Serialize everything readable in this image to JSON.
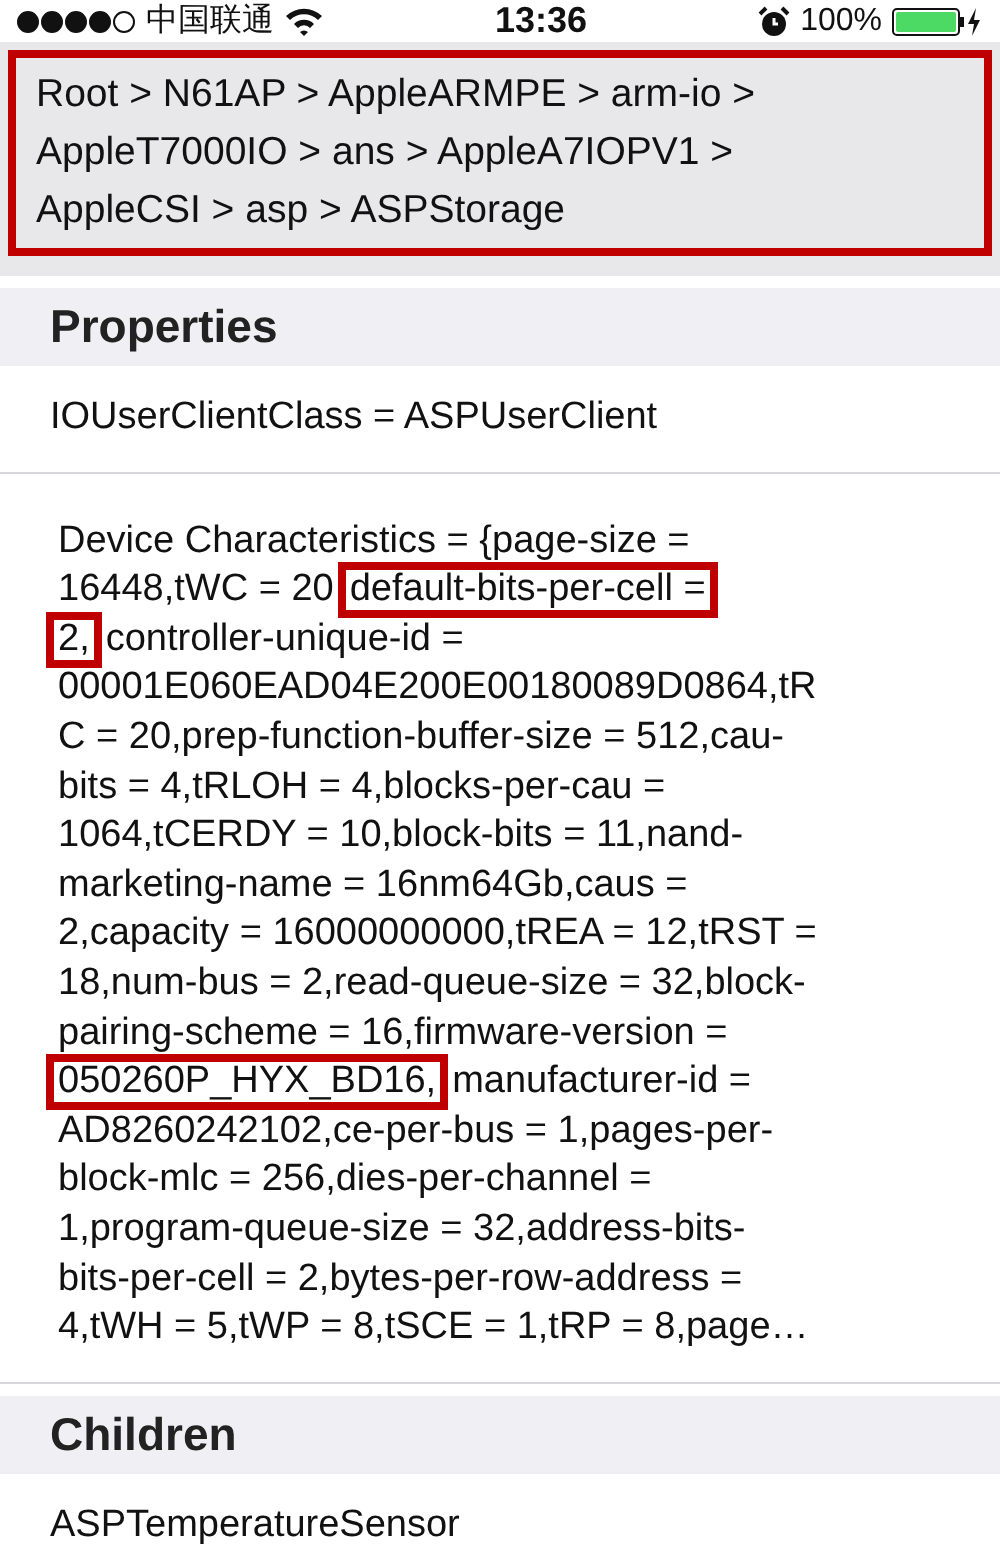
{
  "status_bar": {
    "carrier": "中国联通",
    "time": "13:36",
    "battery": "100%"
  },
  "breadcrumb": {
    "text": "Root > N61AP > AppleARMPE > arm-io > AppleT7000IO > ans > AppleA7IOPV1 > AppleCSI > asp > ASPStorage",
    "marked": true
  },
  "sections": [
    {
      "title": "Properties",
      "rows": [
        {
          "kind": "simple",
          "text": "IOUserClientClass = ASPUserClient"
        },
        {
          "kind": "long",
          "lines": [
            [
              {
                "text": "Device Characteristics = {page-size =",
                "marked": false
              }
            ],
            [
              {
                "text": "16448,tWC = 20 ",
                "marked": false
              },
              {
                "text": "default-bits-per-cell =",
                "marked": true
              }
            ],
            [
              {
                "text": "2,",
                "marked": true
              },
              {
                "text": "controller-unique-id =",
                "marked": false
              }
            ],
            [
              {
                "text": "00001E060EAD04E200E00180089D0864,tR",
                "marked": false
              }
            ],
            [
              {
                "text": "C = 20,prep-function-buffer-size = 512,cau-",
                "marked": false
              }
            ],
            [
              {
                "text": "bits = 4,tRLOH = 4,blocks-per-cau =",
                "marked": false
              }
            ],
            [
              {
                "text": "1064,tCERDY = 10,block-bits = 11,nand-",
                "marked": false
              }
            ],
            [
              {
                "text": "marketing-name = 16nm64Gb,caus =",
                "marked": false
              }
            ],
            [
              {
                "text": "2,capacity = 16000000000,tREA = 12,tRST =",
                "marked": false
              }
            ],
            [
              {
                "text": "18,num-bus = 2,read-queue-size = 32,block-",
                "marked": false
              }
            ],
            [
              {
                "text": "pairing-scheme = 16,firmware-version =",
                "marked": false
              }
            ],
            [
              {
                "text": "050260P_HYX_BD16,",
                "marked": true
              },
              {
                "text": "manufacturer-id =",
                "marked": false
              }
            ],
            [
              {
                "text": "AD8260242102,ce-per-bus = 1,pages-per-",
                "marked": false
              }
            ],
            [
              {
                "text": "block-mlc = 256,dies-per-channel =",
                "marked": false
              }
            ],
            [
              {
                "text": "1,program-queue-size = 32,address-bits-",
                "marked": false
              }
            ],
            [
              {
                "text": "bits-per-cell = 2,bytes-per-row-address =",
                "marked": false
              }
            ],
            [
              {
                "text": "4,tWH = 5,tWP = 8,tSCE = 1,tRP = 8,page…",
                "marked": false
              }
            ]
          ]
        }
      ]
    },
    {
      "title": "Children",
      "rows": [
        {
          "kind": "simple",
          "text": "ASPTemperatureSensor"
        }
      ]
    }
  ]
}
